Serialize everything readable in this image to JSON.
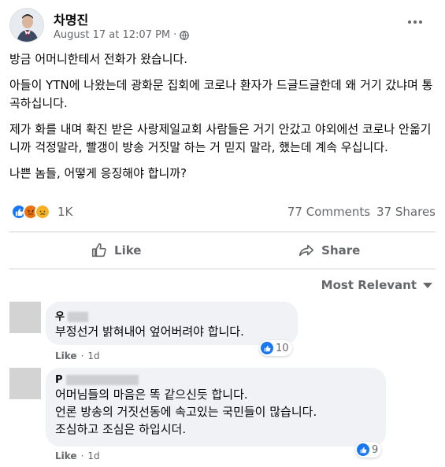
{
  "post": {
    "author": "차명진",
    "date": "August 17 at 12:07 PM",
    "separator": "·",
    "privacy_icon": "globe-icon",
    "paragraphs": [
      "방금 어머니한테서 전화가 왔습니다.",
      "아들이 YTN에 나왔는데 광화문 집회에 코로나 환자가 드글드글한데 왜 거기 갔냐며 통곡하십니다.",
      "제가 화를 내며 확진 받은 사랑제일교회 사람들은 거기 안갔고 야외에선 코로나 안옮기니까 걱정말라, 빨갱이 방송 거짓말 하는 거 믿지 말라, 했는데 계속 우십니다.",
      "나쁜 놈들, 어떻게 응징해야 합니까?"
    ]
  },
  "stats": {
    "reactions": [
      "like",
      "angry",
      "sad"
    ],
    "reaction_count": "1K",
    "comments": "77 Comments",
    "shares": "37 Shares"
  },
  "actions": {
    "like": "Like",
    "share": "Share"
  },
  "sort": {
    "label": "Most Relevant"
  },
  "comments": [
    {
      "name_initial": "우",
      "text_lines": [
        "부정선거 밝혀내어 엎어버려야 합니다."
      ],
      "like_count": "10",
      "like_label": "Like",
      "separator": "·",
      "age": "1d"
    },
    {
      "name_initial": "P",
      "text_lines": [
        "어머님들의 마음은 똑 같으신듯 합니다.",
        "언론 방송의 거짓선동에 속고있는 국민들이 많습니다.",
        "조심하고 조심은 하입시더."
      ],
      "like_count": "9",
      "like_label": "Like",
      "separator": "·",
      "age": "1d"
    }
  ],
  "colors": {
    "accent": "#1877f2",
    "secondary_text": "#65676b",
    "bubble": "#f0f2f5",
    "divider": "#ced0d4"
  }
}
